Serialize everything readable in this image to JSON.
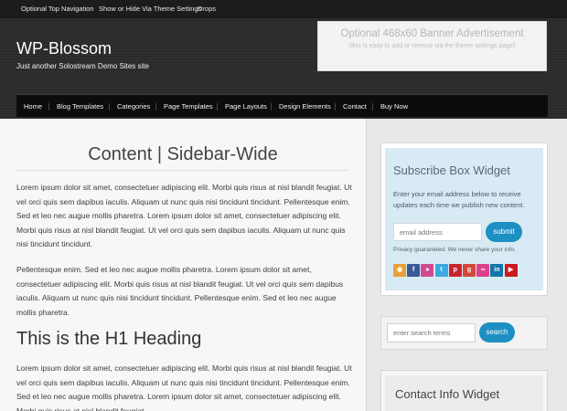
{
  "top_nav": {
    "items": [
      "Optional Top Navigation",
      "Show or Hide Via Theme Settings",
      "Drops"
    ]
  },
  "header": {
    "site_title": "WP-Blossom",
    "tagline": "Just another Solostream Demo Sites site",
    "banner_title": "Optional 468x60 Banner Advertisement",
    "banner_subtitle": "(this is easy to add or remove via the theme settings page)"
  },
  "main_nav": {
    "items": [
      "Home",
      "Blog Templates",
      "Categories",
      "Page Templates",
      "Page Layouts",
      "Design Elements",
      "Contact",
      "Buy Now"
    ]
  },
  "content": {
    "page_title": "Content | Sidebar-Wide",
    "paragraph_1": "Lorem ipsum dolor sit amet, consectetuer adipiscing elit. Morbi quis risus at nisl blandit feugiat. Ut vel orci quis sem dapibus iaculis. Aliquam ut nunc quis nisi tincidunt tincidunt. Pellentesque enim. Sed et leo nec augue mollis pharetra. Lorem ipsum dolor sit amet, consectetuer adipiscing elit. Morbi quis risus at nisl blandit feugiat. Ut vel orci quis sem dapibus iaculis. Aliquam ut nunc quis nisi tincidunt tincidunt.",
    "paragraph_2": "Pellentesque enim. Sed et leo nec augue mollis pharetra. Lorem ipsum dolor sit amet, consectetuer adipiscing elit. Morbi quis risus at nisl blandit feugiat. Ut vel orci quis sem dapibus iaculis. Aliquam ut nunc quis nisi tincidunt tincidunt. Pellentesque enim. Sed et leo nec augue mollis pharetra.",
    "h1_heading": "This is the H1 Heading",
    "paragraph_3": "Lorem ipsum dolor sit amet, consectetuer adipiscing elit. Morbi quis risus at nisl blandit feugiat. Ut vel orci quis sem dapibus iaculis. Aliquam ut nunc quis nisi tincidunt tincidunt. Pellentesque enim. Sed et leo nec augue mollis pharetra. Lorem ipsum dolor sit amet, consectetuer adipiscing elit. Morbi quis risus at nisl blandit feugiat."
  },
  "sidebar": {
    "subscribe": {
      "title": "Subscribe Box Widget",
      "description": "Enter your email address below to receive updates each time we publish new content.",
      "email_placeholder": "email address",
      "submit_label": "submit",
      "privacy": "Privacy guaranteed. We never share your info.",
      "social_icons": [
        {
          "name": "rss-icon",
          "glyph": "◉",
          "color": "#e8a03a"
        },
        {
          "name": "facebook-icon",
          "glyph": "f",
          "color": "#3b5998"
        },
        {
          "name": "flickr-icon",
          "glyph": "●",
          "color": "#d14a91"
        },
        {
          "name": "twitter-icon",
          "glyph": "t",
          "color": "#3aaae0"
        },
        {
          "name": "pinterest-icon",
          "glyph": "p",
          "color": "#c8232c"
        },
        {
          "name": "googleplus-icon",
          "glyph": "g",
          "color": "#d34836"
        },
        {
          "name": "flickr-dots-icon",
          "glyph": "∞",
          "color": "#de3f8b"
        },
        {
          "name": "linkedin-icon",
          "glyph": "in",
          "color": "#0e76a8"
        },
        {
          "name": "youtube-icon",
          "glyph": "▶",
          "color": "#cc181e"
        }
      ]
    },
    "search": {
      "placeholder": "enter search terms",
      "button_label": "search"
    },
    "contact": {
      "title": "Contact Info Widget"
    }
  }
}
